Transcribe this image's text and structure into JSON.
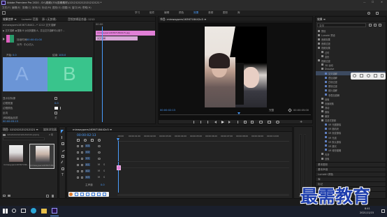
{
  "app": {
    "title": "Adobe Premiere Pro 2020 - D:\\\\视频\\\\70\\\\剪辑素材\\\\1212121212121212121 *",
    "menu": [
      "文件(F)",
      "编辑(E)",
      "剪辑(C)",
      "序列(S)",
      "标记(M)",
      "图形(G)",
      "视图(V)",
      "窗口(W)",
      "帮助(H)"
    ],
    "workspaces": [
      "学习",
      "组件",
      "编辑",
      "颜色",
      "效果",
      "音频",
      "图形",
      "库"
    ],
    "active_workspace_index": 4,
    "colors": {
      "accent_blue": "#4a9eff",
      "pink_clip": "#e07fd6",
      "transition_a": "#6a96d9",
      "transition_b": "#38c58b"
    }
  },
  "effect_controls": {
    "tabs": [
      "效果控件 ≡",
      "Lumetri 范围",
      "源: (无剪辑)",
      "音频剪辑混合器: 1212"
    ],
    "header_line": "minwaypers1636718442...* 1212 交叉溶解",
    "desc_line": "▶ 交叉溶解 ◀ 图像 B 淡化到图像 A，并且交叉溶解可以用于...",
    "duration_label": "持续时间",
    "duration_value": "00:00:01:00",
    "alignment_label": "对齐:",
    "alignment_value": "中心切入",
    "start_label": "开始:",
    "start_value": "0.0",
    "end_label": "结束:",
    "end_value": "100.0",
    "preview_a": "A",
    "preview_b": "B",
    "options": [
      {
        "label": "显示实际源",
        "control": "checkbox"
      },
      {
        "label": "边框宽度",
        "value": "0.0"
      },
      {
        "label": "边框颜色",
        "control": "color"
      },
      {
        "label": "反向",
        "control": "checkbox"
      },
      {
        "label": "消除锯齿品质",
        "value": "关"
      }
    ],
    "mini_timeline": {
      "timecode": "00:00",
      "clip_label": "minwaypers1636718442c5.jpg",
      "clip2_label": "交叉溶解"
    },
    "footer_timecode": "00:00:03:13"
  },
  "program": {
    "tab": "节目: minwaypers1636718442c5 ≡",
    "timecode": "00:00:02:13",
    "fit": "完整",
    "duration": "00:00:05:00",
    "controls": [
      "mark-in-icon",
      "mark-out-icon",
      "go-to-in-icon",
      "step-back-icon",
      "play-icon",
      "step-forward-icon",
      "go-to-out-icon",
      "lift-icon",
      "extract-icon",
      "export-frame-icon",
      "compare-icon",
      "vr-icon"
    ]
  },
  "project": {
    "tabs": [
      "项目: 121212121212121 ≡",
      "媒体浏览器"
    ],
    "folder": "1212121212121212121.prproj",
    "items_count": "2 项",
    "items": [
      {
        "name": "minwaypers16367184..."
      },
      {
        "name": "minwaypers16367184..."
      }
    ]
  },
  "timeline": {
    "tab": "minwaypers1636718442c5 ≡",
    "timecode": "00:00:02:13",
    "ruler": [
      ":00:00",
      "00:00:01:00",
      "00:00:02:00",
      "00:00:03:00",
      "00:00:04:00",
      "00:00:05:00",
      "00:00:06:00",
      "00:00:07:00",
      "00:00:08:00",
      "00:00:09:00",
      "00:00:10:00"
    ],
    "tracks": [
      "V3",
      "V2",
      "V1",
      "A1",
      "A2",
      "A3"
    ],
    "master": "主声道",
    "master_value": "0.0"
  },
  "effects": {
    "tab": "效果 ≡",
    "search_placeholder": "交叉",
    "tree": [
      {
        "label": "预设",
        "indent": 0
      },
      {
        "label": "Lumetri 预设",
        "indent": 0
      },
      {
        "label": "音频效果",
        "indent": 0
      },
      {
        "label": "音频过渡",
        "indent": 0
      },
      {
        "label": "视频效果",
        "indent": 0
      },
      {
        "label": "过时",
        "indent": 1
      },
      {
        "label": "变形",
        "indent": 1
      },
      {
        "label": "视频过渡",
        "indent": 0
      },
      {
        "label": "3D 运动",
        "indent": 1
      },
      {
        "label": "Dissolve",
        "indent": 1
      },
      {
        "label": "交叉溶解",
        "indent": 2
      },
      {
        "label": "叠加溶解",
        "indent": 2
      },
      {
        "label": "白场过渡",
        "indent": 2
      },
      {
        "label": "黑场过渡",
        "indent": 2
      },
      {
        "label": "胶片溶解",
        "indent": 2
      },
      {
        "label": "非叠加溶解",
        "indent": 2
      },
      {
        "label": "划像",
        "indent": 1
      },
      {
        "label": "页面剥落",
        "indent": 1
      },
      {
        "label": "滑动",
        "indent": 1
      },
      {
        "label": "擦除",
        "indent": 1
      },
      {
        "label": "缩放",
        "indent": 1
      },
      {
        "label": "沉浸式视频",
        "indent": 1
      },
      {
        "label": "VR 光圈擦除",
        "indent": 2
      },
      {
        "label": "VR 随机块",
        "indent": 2
      },
      {
        "label": "VR 渐变擦除",
        "indent": 2
      },
      {
        "label": "VR 光线",
        "indent": 2
      },
      {
        "label": "VR 默认擦除",
        "indent": 2
      },
      {
        "label": "VR 漏光",
        "indent": 2
      },
      {
        "label": "VR 球形模糊",
        "indent": 2
      },
      {
        "label": "内滑",
        "indent": 1
      },
      {
        "label": "划像",
        "indent": 1
      }
    ],
    "sections": [
      "基本图形",
      "基本声音",
      "Lumetri 颜色",
      "库",
      "标记",
      "历史记录",
      "信息"
    ]
  },
  "watermark": "最需教育",
  "taskbar": {
    "time": "8:41",
    "date": "2021/11/15"
  }
}
